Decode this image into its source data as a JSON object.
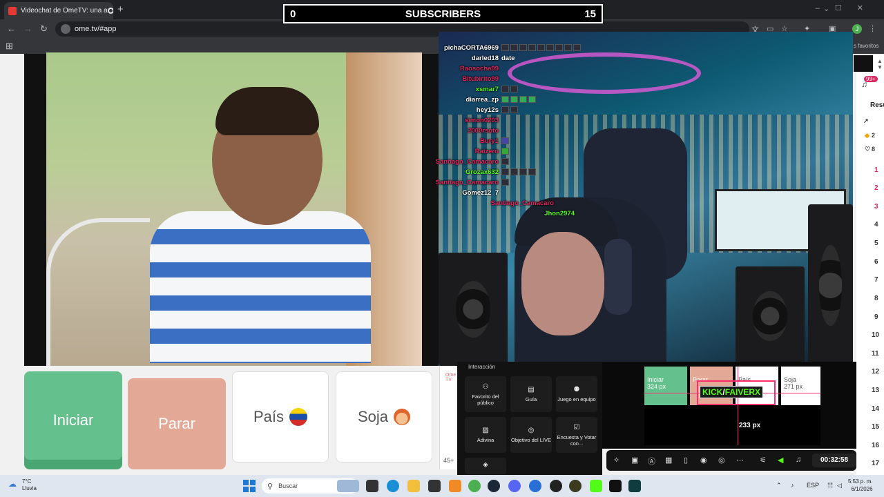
{
  "browser": {
    "tab_title": "Videochat de OmeTV: una a",
    "url": "ome.tv/#app",
    "bookmarks_label": "s favoritos",
    "profile_initial": "J"
  },
  "overlay": {
    "sub_left": "0",
    "sub_title": "SUBSCRIBERS",
    "sub_right": "15"
  },
  "chat": [
    {
      "name": "pichaCORTA6969",
      "color": "#ffffff",
      "msg": ""
    },
    {
      "name": "darled18",
      "color": "#ffffff",
      "msg": "date"
    },
    {
      "name": "Raosocha99",
      "color": "#e0245e",
      "msg": ""
    },
    {
      "name": "Bitubirito99",
      "color": "#e0245e",
      "msg": ""
    },
    {
      "name": "xsmar7",
      "color": "#53fc18",
      "msg": ""
    },
    {
      "name": "diarrea_zp",
      "color": "#ffffff",
      "msg": ""
    },
    {
      "name": "hey12s",
      "color": "#ffffff",
      "msg": ""
    },
    {
      "name": "simon0203",
      "color": "#e0245e",
      "msg": ""
    },
    {
      "name": "2000rsoto",
      "color": "#e0245e",
      "msg": ""
    },
    {
      "name": "Bury1",
      "color": "#e0245e",
      "msg": ""
    },
    {
      "name": "Raizero",
      "color": "#e0245e",
      "msg": ""
    },
    {
      "name": "Santiago_Camacaro",
      "color": "#e0245e",
      "msg": ""
    },
    {
      "name": "Grozax632",
      "color": "#53fc18",
      "msg": ""
    },
    {
      "name": "Santiago_Camacaro",
      "color": "#e0245e",
      "msg": ""
    },
    {
      "name": "Gomez12_7",
      "color": "#ffffff",
      "msg": ""
    },
    {
      "name": "Santiago_Camacaro",
      "color": "#e0245e",
      "msg": ""
    },
    {
      "name": "Jhon2974",
      "color": "#53fc18",
      "msg": ""
    }
  ],
  "ome": {
    "start": "Iniciar",
    "stop": "Parar",
    "country": "País",
    "gender": "Soja",
    "small_count": "45+"
  },
  "interaction": {
    "title": "Interacción",
    "tiles": [
      {
        "label": "Favorito del público",
        "icon": "people-icon"
      },
      {
        "label": "Guía",
        "icon": "book-icon"
      },
      {
        "label": "Juego en equipo",
        "icon": "team-icon"
      },
      {
        "label": "Adivina",
        "icon": "guess-icon"
      },
      {
        "label": "Objetivo del LIVE",
        "icon": "target-icon"
      },
      {
        "label": "Encuesta y Votar con...",
        "icon": "poll-icon"
      }
    ]
  },
  "preview": {
    "start": "Iniciar",
    "start_px": "324 px",
    "stop": "Parar",
    "country": "País",
    "gender": "Soja",
    "gender_px": "271 px",
    "kick_a": "KICK",
    "kick_sep": "/",
    "kick_b": "FAIVERX",
    "height_px": "233 px"
  },
  "controls": {
    "timer": "00:32:58"
  },
  "right_panel": {
    "badge": "99+",
    "heading": "Resu",
    "stat1": "2",
    "stat2": "8",
    "ranks": [
      "1",
      "2",
      "3",
      "4",
      "5",
      "6",
      "7",
      "8",
      "9",
      "10",
      "11",
      "12",
      "13",
      "14",
      "15",
      "16",
      "17"
    ]
  },
  "taskbar": {
    "temp": "7°C",
    "weather": "Lluvia",
    "search": "Buscar",
    "lang": "ESP",
    "time": "5:53 p. m.",
    "date": "6/1/2026"
  },
  "colors": {
    "start_green": "#64c08c",
    "stop_salmon": "#e3a896",
    "kick_green": "#53fc18",
    "accent_pink": "#ff2d6b"
  }
}
